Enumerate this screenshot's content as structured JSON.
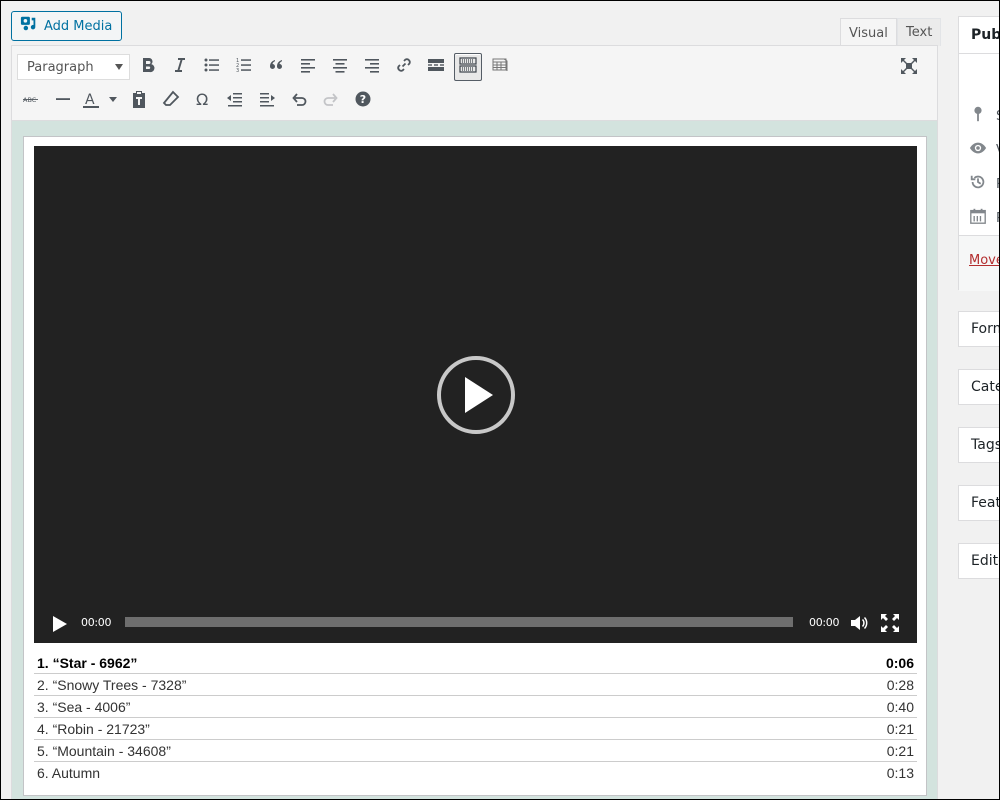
{
  "add_media": {
    "label": "Add Media",
    "icon": "add-media-icon"
  },
  "tabs": [
    {
      "label": "Visual",
      "active": true
    },
    {
      "label": "Text",
      "active": false
    }
  ],
  "toolbar": {
    "format_select": {
      "value": "Paragraph"
    },
    "row1": [
      {
        "name": "bold",
        "icon": "bold-icon"
      },
      {
        "name": "italic",
        "icon": "italic-icon"
      },
      {
        "name": "bulleted-list",
        "icon": "bulleted-list-icon"
      },
      {
        "name": "numbered-list",
        "icon": "numbered-list-icon"
      },
      {
        "name": "blockquote",
        "icon": "quote-icon"
      },
      {
        "name": "align-left",
        "icon": "align-left-icon"
      },
      {
        "name": "align-center",
        "icon": "align-center-icon"
      },
      {
        "name": "align-right",
        "icon": "align-right-icon"
      },
      {
        "name": "insert-link",
        "icon": "link-icon"
      },
      {
        "name": "read-more",
        "icon": "read-more-icon"
      },
      {
        "name": "toolbar-toggle",
        "icon": "keyboard-icon",
        "active": true
      },
      {
        "name": "table",
        "icon": "table-icon"
      }
    ],
    "row2": [
      {
        "name": "strikethrough",
        "icon": "strikethrough-icon"
      },
      {
        "name": "horizontal-line",
        "icon": "horizontal-line-icon"
      },
      {
        "name": "text-color",
        "icon": "text-color-icon"
      },
      {
        "name": "paste-as-text",
        "icon": "paste-text-icon"
      },
      {
        "name": "clear-formatting",
        "icon": "eraser-icon"
      },
      {
        "name": "special-character",
        "icon": "omega-icon"
      },
      {
        "name": "decrease-indent",
        "icon": "outdent-icon"
      },
      {
        "name": "increase-indent",
        "icon": "indent-icon"
      },
      {
        "name": "undo",
        "icon": "undo-icon"
      },
      {
        "name": "redo",
        "icon": "redo-icon",
        "disabled": true
      },
      {
        "name": "keyboard-shortcuts",
        "icon": "help-icon"
      }
    ],
    "text_color_glyph": "A",
    "expand_icon": "fullscreen-expand-icon"
  },
  "player": {
    "current_time": "00:00",
    "duration": "00:00",
    "progress": 0
  },
  "playlist": [
    {
      "label": "1. “Star - 6962”",
      "duration": "0:06",
      "current": true
    },
    {
      "label": "2. “Snowy Trees - 7328”",
      "duration": "0:28",
      "current": false
    },
    {
      "label": "3. “Sea - 4006”",
      "duration": "0:40",
      "current": false
    },
    {
      "label": "4. “Robin - 21723”",
      "duration": "0:21",
      "current": false
    },
    {
      "label": "5. “Mountain - 34608”",
      "duration": "0:21",
      "current": false
    },
    {
      "label": "6. Autumn",
      "duration": "0:13",
      "current": false
    }
  ],
  "sidebar": {
    "publish": {
      "title": "Publ",
      "rows": [
        {
          "icon": "pin-icon",
          "text": "S"
        },
        {
          "icon": "eye-icon",
          "text": "V"
        },
        {
          "icon": "history-icon",
          "text": "R"
        },
        {
          "icon": "calendar-icon",
          "text": "P"
        }
      ],
      "trash_link": "Move"
    },
    "boxes": [
      {
        "title": "Form"
      },
      {
        "title": "Cate"
      },
      {
        "title": "Tags"
      },
      {
        "title": "Feat"
      },
      {
        "title": "Edito"
      }
    ]
  }
}
